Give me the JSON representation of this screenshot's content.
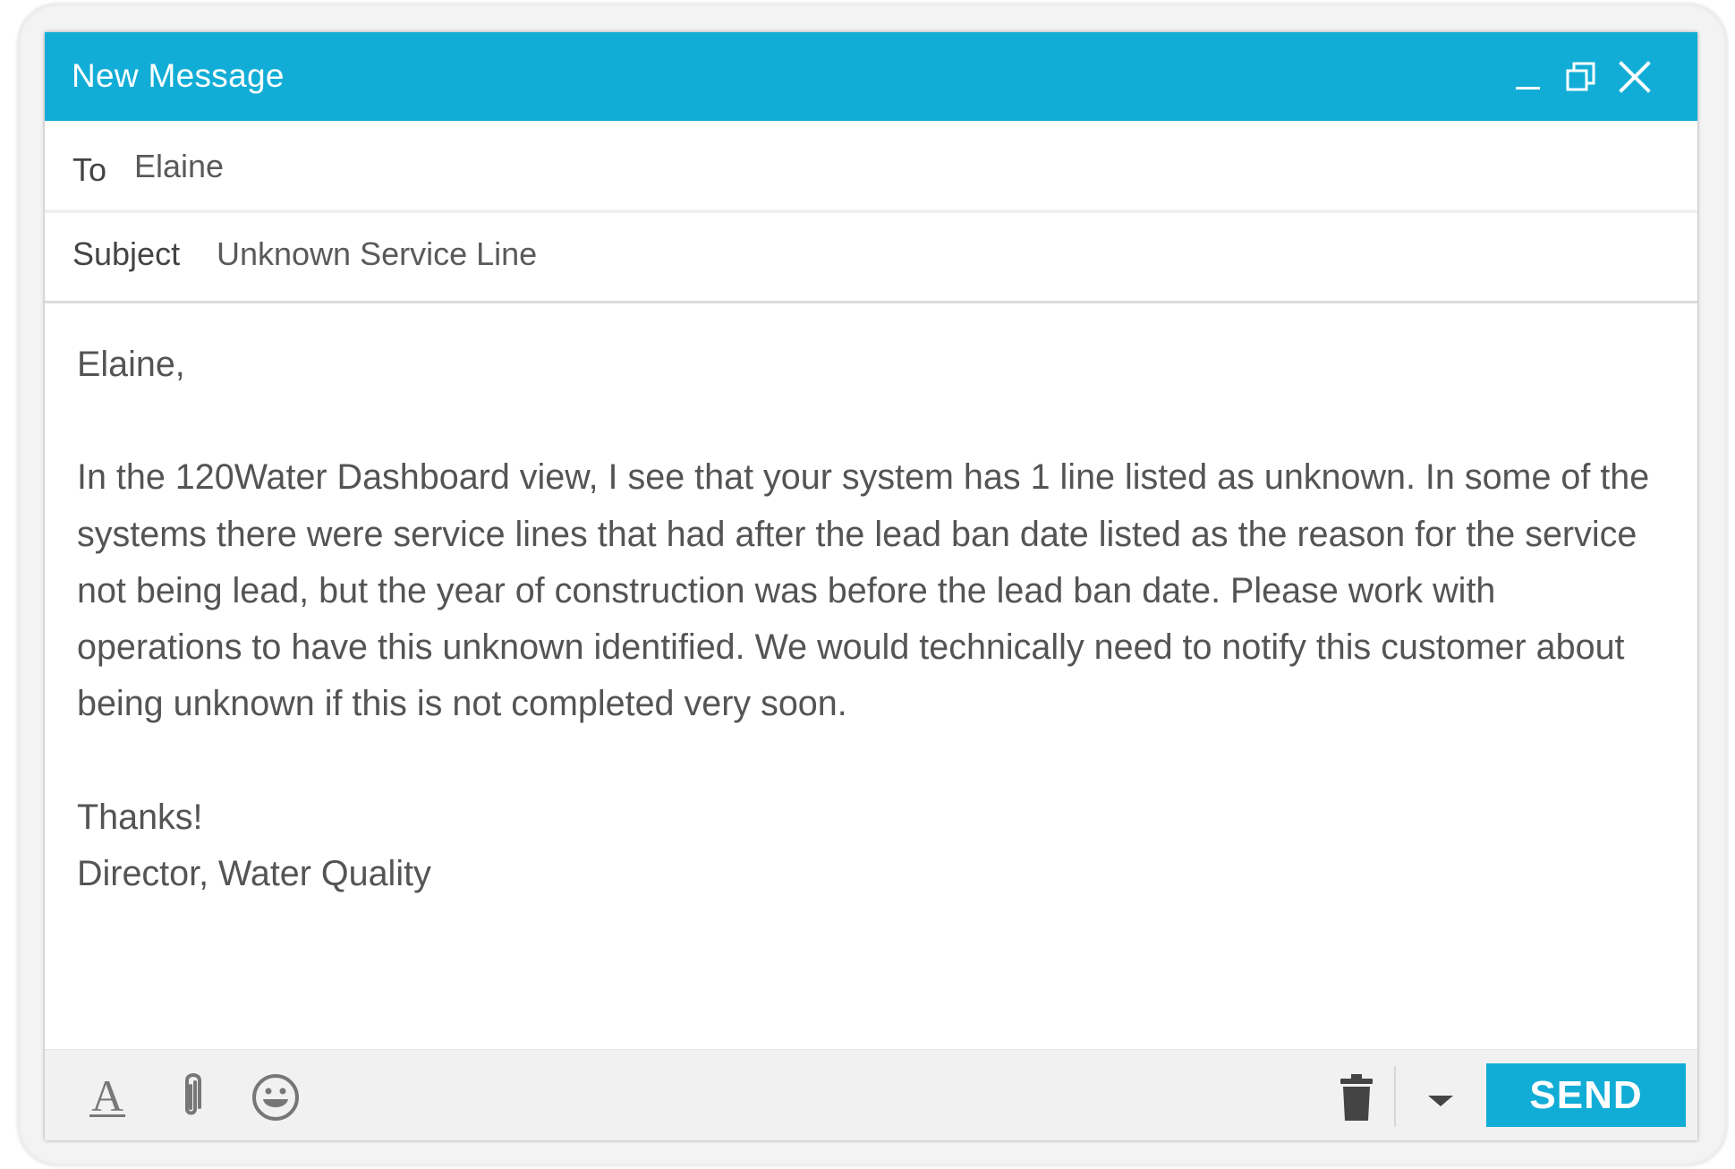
{
  "window": {
    "title": "New Message",
    "accent_color": "#12add6",
    "controls": [
      "minimize-icon",
      "restore-icon",
      "close-icon"
    ]
  },
  "fields": {
    "to_label": "To",
    "to_value": "Elaine",
    "subject_label": "Subject",
    "subject_value": "Unknown Service Line"
  },
  "body": {
    "greeting": "Elaine,",
    "paragraph": "In the 120Water Dashboard view, I see that your system has 1 line listed as unknown. In some of the systems there were service lines that had after the lead ban date listed as the reason for the service not being lead, but the year of construction was before the lead ban date. Please work with operations to have this unknown identified. We would technically need to notify this customer about being unknown if this is not completed very soon.",
    "closing": "Thanks!",
    "signature": "Director, Water Quality"
  },
  "toolbar": {
    "icons": [
      "text-format-icon",
      "paperclip-icon",
      "emoji-icon",
      "trash-icon",
      "dropdown-caret-icon"
    ],
    "send_label": "SEND"
  }
}
